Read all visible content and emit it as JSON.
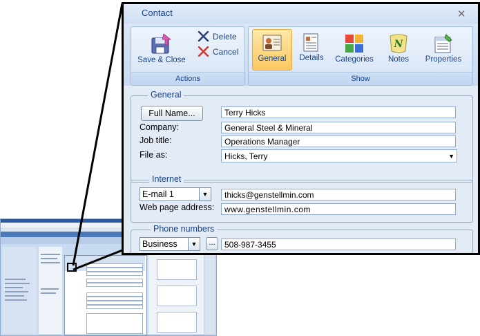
{
  "window": {
    "title": "Contact"
  },
  "ribbon": {
    "actions": {
      "label": "Actions",
      "save_close": "Save & Close",
      "delete": "Delete",
      "cancel": "Cancel"
    },
    "show": {
      "label": "Show",
      "general": "General",
      "details": "Details",
      "categories": "Categories",
      "notes": "Notes",
      "properties": "Properties"
    }
  },
  "general": {
    "section_title": "General",
    "full_name_button": "Full Name...",
    "full_name": "Terry Hicks",
    "company_label": "Company:",
    "company": "General Steel & Mineral",
    "job_title_label": "Job title:",
    "job_title": "Operations Manager",
    "file_as_label": "File as:",
    "file_as": "Hicks, Terry"
  },
  "internet": {
    "section_title": "Internet",
    "email_type": "E-mail 1",
    "email": "thicks@genstellmin.com",
    "web_label": "Web page address:",
    "web": "www.genstellmin.com"
  },
  "phones": {
    "section_title": "Phone numbers",
    "type": "Business",
    "more_button": "...",
    "number": "508-987-3455"
  },
  "colors": {
    "accent": "#15428b",
    "selected": "#fbc861",
    "panel": "#e3ebf7"
  }
}
